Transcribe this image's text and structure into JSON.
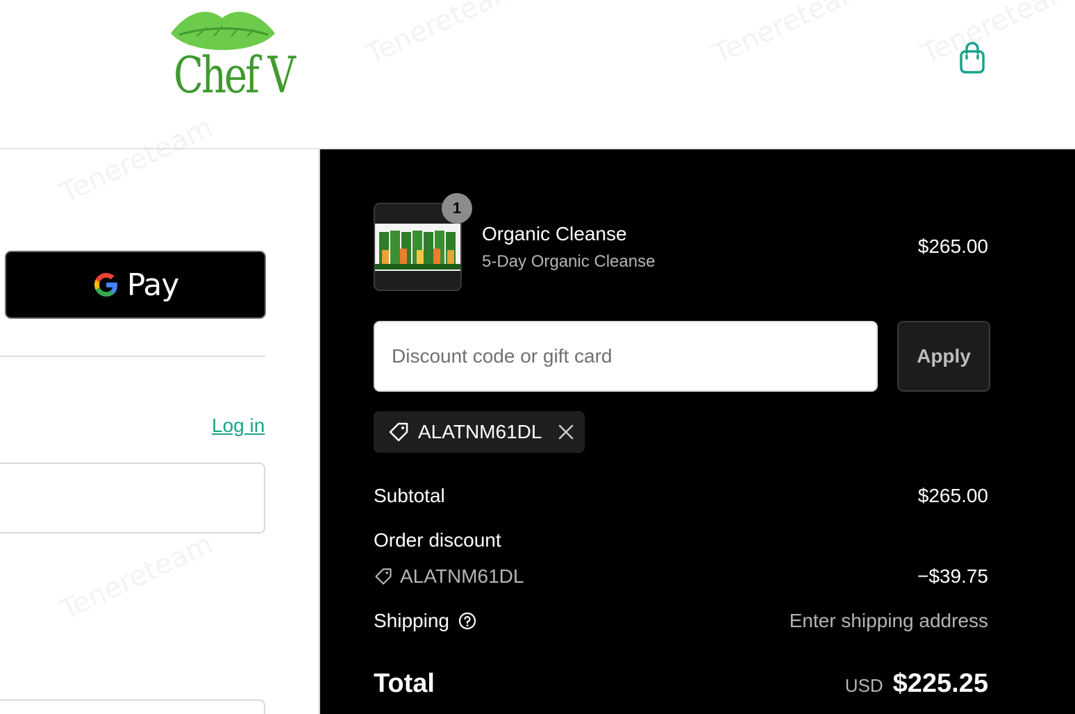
{
  "brand": {
    "logo_text": "Chef V",
    "logo_color": "#3f9a2e",
    "lips_color": "#6ccb4a"
  },
  "header": {
    "cart_icon": "shopping-bag-icon",
    "accent_color": "#1aa38c"
  },
  "express_checkout": {
    "gpay_label": "Pay"
  },
  "account": {
    "login_label": "Log in"
  },
  "order_summary": {
    "item": {
      "quantity": "1",
      "name": "Organic Cleanse",
      "variant": "5-Day Organic Cleanse",
      "price": "$265.00"
    },
    "discount_input": {
      "placeholder": "Discount code or gift card",
      "value": ""
    },
    "apply_label": "Apply",
    "applied_code": "ALATNM61DL",
    "subtotal_label": "Subtotal",
    "subtotal_value": "$265.00",
    "order_discount_label": "Order discount",
    "discount_code": "ALATNM61DL",
    "discount_value": "−$39.75",
    "shipping_label": "Shipping",
    "shipping_value": "Enter shipping address",
    "total_label": "Total",
    "currency": "USD",
    "total_value": "$225.25"
  },
  "watermark": {
    "text": "Tenereteam"
  }
}
